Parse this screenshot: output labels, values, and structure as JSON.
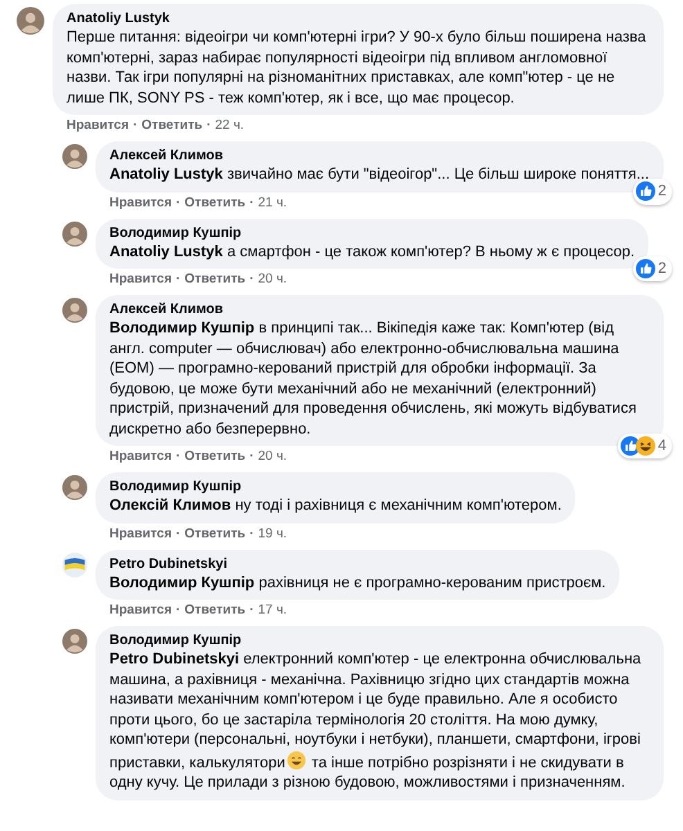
{
  "comments": [
    {
      "author": "Anatoliy Lustyk",
      "avatar": {
        "kind": "photo"
      },
      "text": [
        "Перше питання: відеоігри чи комп'ютерні ігри? У 90-х було більш поширена назва комп'ютерні, зараз набирає популярності відеоігри під впливом англомовної назви. Так ігри популярні на різноманітних приставках, але комп\"ютер - це не лише ПК, SONY PS - теж комп'ютер, як і все, що має процесор."
      ],
      "actions": {
        "like": "Нравится",
        "separator": "·",
        "reply": "Ответить",
        "time": "22 ч."
      },
      "replies": [
        {
          "author": "Алексей Климов",
          "avatar": {
            "kind": "photo"
          },
          "mention": "Anatoliy Lustyk",
          "text": [
            "звичайно має бути \"відеоігор\"... Це більш широке поняття..."
          ],
          "actions": {
            "like": "Нравится",
            "separator": "·",
            "reply": "Ответить",
            "time": "21 ч."
          },
          "reactions": {
            "items": [
              {
                "kind": "like"
              }
            ],
            "count": "2"
          }
        },
        {
          "author": "Володимир Кушпір",
          "avatar": {
            "kind": "photo"
          },
          "mention": "Anatoliy Lustyk",
          "text": [
            "а смартфон - це також комп'ютер? В ньому ж є процесор."
          ],
          "actions": {
            "like": "Нравится",
            "separator": "·",
            "reply": "Ответить",
            "time": "20 ч."
          },
          "reactions": {
            "items": [
              {
                "kind": "like"
              }
            ],
            "count": "2"
          }
        },
        {
          "author": "Алексей Климов",
          "avatar": {
            "kind": "photo"
          },
          "mention": "Володимир Кушпір",
          "text": [
            "в принципі так... Вікіпедія каже так: Комп'ютер (від англ. computer — обчислювач) або електронно-обчислювальна машина (ЕОМ) — програмно-керований пристрій для обробки інформації. За будовою, це може бути механічний або не механічний (електронний) пристрій, призначений для проведення обчислень, які можуть відбуватися дискретно або безперервно."
          ],
          "actions": {
            "like": "Нравится",
            "separator": "·",
            "reply": "Ответить",
            "time": "20 ч."
          },
          "reactions": {
            "items": [
              {
                "kind": "like"
              },
              {
                "kind": "haha"
              }
            ],
            "count": "4"
          }
        },
        {
          "author": "Володимир Кушпір",
          "avatar": {
            "kind": "photo"
          },
          "mention": "Олексій Климов",
          "text": [
            "ну тоді і рахівниця є механічним комп'ютером."
          ],
          "actions": {
            "like": "Нравится",
            "separator": "·",
            "reply": "Ответить",
            "time": "19 ч."
          }
        },
        {
          "author": "Petro Dubinetskyi",
          "avatar": {
            "kind": "flag"
          },
          "mention": "Володимир Кушпір",
          "text": [
            "рахівниця не є програмно-керованим пристроєм."
          ],
          "actions": {
            "like": "Нравится",
            "separator": "·",
            "reply": "Ответить",
            "time": "17 ч."
          }
        },
        {
          "author": "Володимир Кушпір",
          "avatar": {
            "kind": "photo"
          },
          "mention": "Petro Dubinetskyi",
          "text": [
            "електронний комп'ютер - це електронна обчислювальна машина, а рахівниця - механічна. Рахівницю згідно цих стандартів можна називати механічним комп'ютером і це буде правильно. Але я особисто проти цього, бо це застаріла термінологія 20 століття. На мою думку, комп'ютери (персональні, ноутбуки і нетбуки), планшети, смартфони, ігрові приставки, калькулятори",
            "та інше потрібно розрізняти і не скидувати в одну кучу. Це прилади з різною будовою, можливостями і призначенням."
          ]
        }
      ]
    }
  ]
}
